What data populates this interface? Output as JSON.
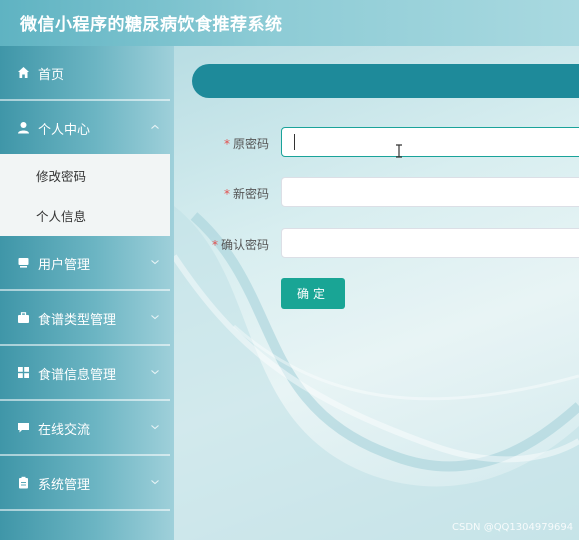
{
  "header": {
    "title": "微信小程序的糖尿病饮食推荐系统"
  },
  "sidebar": {
    "items": [
      {
        "label": "首页",
        "icon": "home-icon"
      },
      {
        "label": "个人中心",
        "icon": "user-icon"
      },
      {
        "label": "用户管理",
        "icon": "monitor-icon"
      },
      {
        "label": "食谱类型管理",
        "icon": "briefcase-icon"
      },
      {
        "label": "食谱信息管理",
        "icon": "grid-icon"
      },
      {
        "label": "在线交流",
        "icon": "chat-icon"
      },
      {
        "label": "系统管理",
        "icon": "clipboard-icon"
      }
    ],
    "submenu": [
      {
        "label": "修改密码"
      },
      {
        "label": "个人信息"
      }
    ]
  },
  "form": {
    "fields": [
      {
        "label": "原密码",
        "required_mark": "*",
        "value": ""
      },
      {
        "label": "新密码",
        "required_mark": "*",
        "value": ""
      },
      {
        "label": "确认密码",
        "required_mark": "*",
        "value": ""
      }
    ],
    "confirm_label": "确定"
  },
  "watermark": "CSDN @QQ1304979694",
  "colors": {
    "accent": "#19a595",
    "banner": "#1e8a9a",
    "required": "#e2504f",
    "sidebar": "#4fa3b3"
  }
}
